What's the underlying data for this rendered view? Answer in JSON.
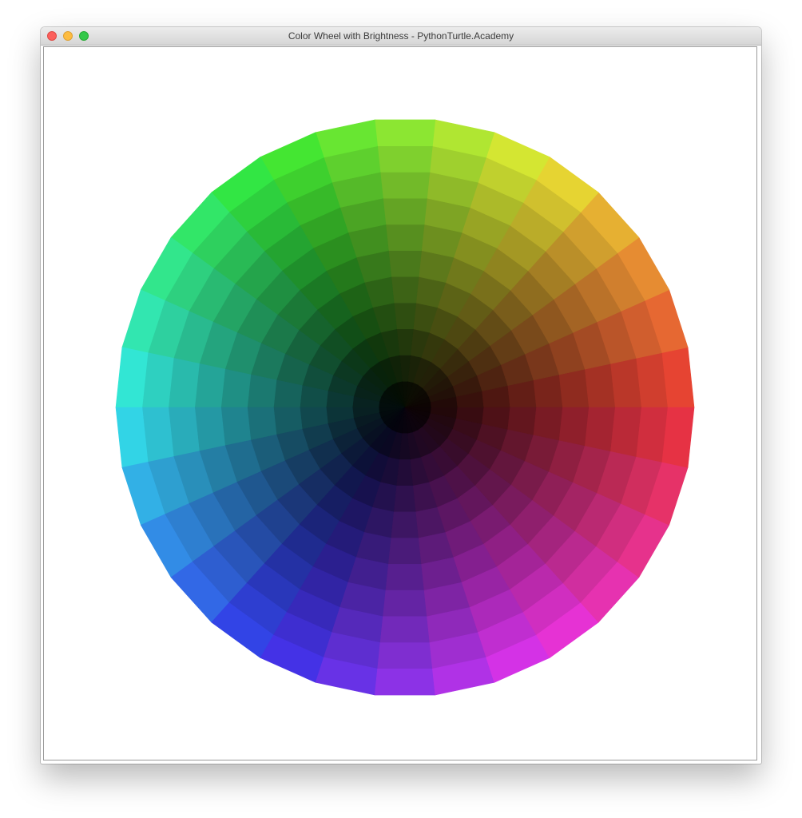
{
  "window": {
    "title": "Color Wheel with Brightness - PythonTurtle.Academy",
    "buttons": {
      "close": "close-icon",
      "minimize": "minimize-icon",
      "maximize": "maximize-icon"
    },
    "traffic_colors": {
      "close": "#fc605c",
      "minimize": "#fdbc40",
      "maximize": "#34c84a"
    }
  },
  "canvas": {
    "background": "#ffffff",
    "wheel": {
      "hue_segments": 30,
      "brightness_rings": 11,
      "hue_start_color": "#e03a3a",
      "direction": "clockwise-hue-decreasing",
      "center_color": "#000000"
    }
  }
}
